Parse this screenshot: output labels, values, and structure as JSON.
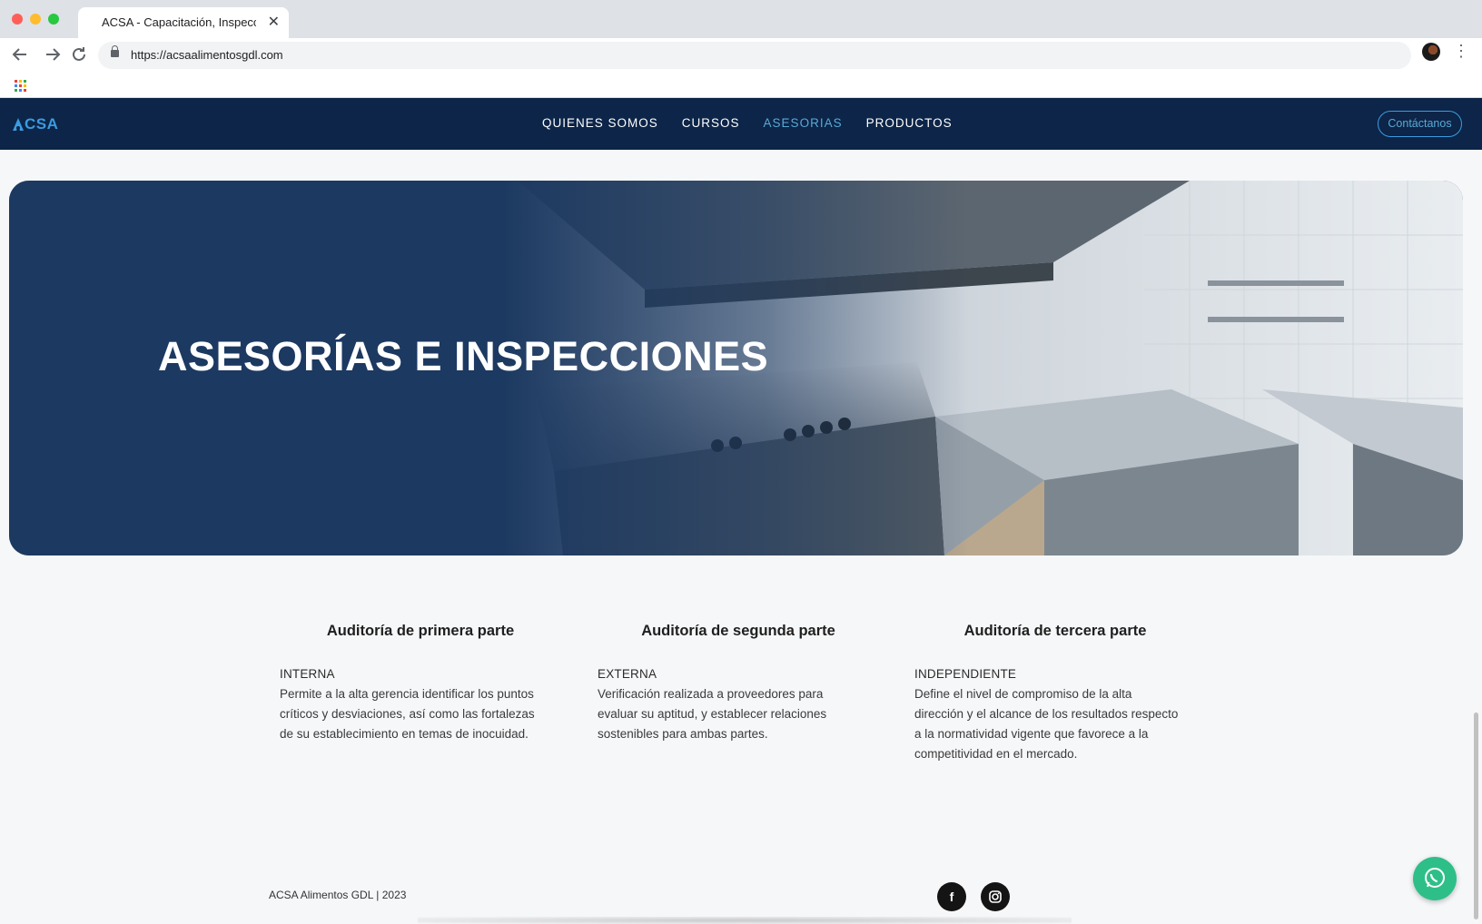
{
  "browser": {
    "tab_title": "ACSA - Capacitación, Inspecci",
    "tab_close": "✕",
    "url": "https://acsaalimentosgdl.com",
    "back_icon": "arrow-left-icon",
    "forward_icon": "arrow-right-icon",
    "reload_icon": "reload-icon"
  },
  "nav": {
    "logo_text": "CSA",
    "items": [
      {
        "label": "QUIENES SOMOS",
        "active": false
      },
      {
        "label": "CURSOS",
        "active": false
      },
      {
        "label": "ASESORIAS",
        "active": true
      },
      {
        "label": "PRODUCTOS",
        "active": false
      }
    ],
    "contact_label": "Contáctanos",
    "accent_color": "#5aa9d6",
    "bg_color": "#0c2548"
  },
  "hero": {
    "title": "ASESORÍAS E INSPECCIONES"
  },
  "cards": [
    {
      "title": "Auditoría de primera parte",
      "kicker": "INTERNA",
      "lines": [
        "Permite a la alta gerencia identificar los puntos",
        "críticos y desviaciones, así como las fortalezas",
        "de su establecimiento en temas de inocuidad."
      ]
    },
    {
      "title": "Auditoría de segunda parte",
      "kicker": "EXTERNA",
      "lines": [
        "Verificación realizada a proveedores para",
        "evaluar su aptitud, y establecer relaciones",
        "sostenibles para ambas partes."
      ]
    },
    {
      "title": "Auditoría de tercera parte",
      "kicker": "INDEPENDIENTE",
      "lines": [
        "Define el nivel de compromiso de la alta",
        "dirección y el alcance de los resultados respecto",
        "a la normatividad vigente que favorece a la",
        "competitividad en el mercado."
      ]
    }
  ],
  "footer": {
    "copyright": "ACSA Alimentos GDL | 2023",
    "facebook_icon": "f",
    "instagram_icon": "instagram-icon"
  }
}
